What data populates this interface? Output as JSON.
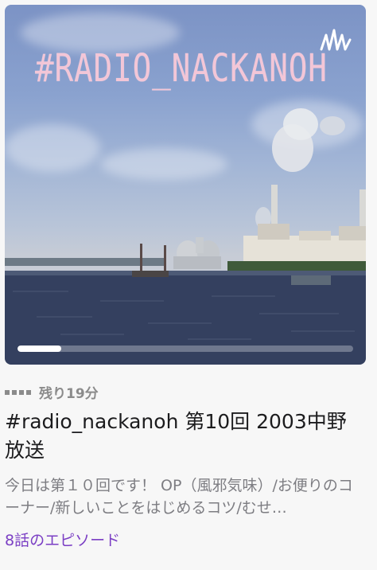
{
  "artwork": {
    "title": "#RADIO_NACKANOH",
    "logo_icon": "anchor-podcast-icon",
    "progress_fraction": 0.13
  },
  "episode": {
    "remaining": "残り19分",
    "title": "#radio_nackanoh 第10回 2003中野放送",
    "description": "今日は第１０回です！ OP（風邪気味）/お便りのコーナー/新しいことをはじめるコツ/むせ…",
    "episodes_link": "8話のエピソード"
  },
  "colors": {
    "accent": "#7b3fc4",
    "title_pink": "#f3c6d7",
    "secondary_text": "#7d7d82"
  }
}
